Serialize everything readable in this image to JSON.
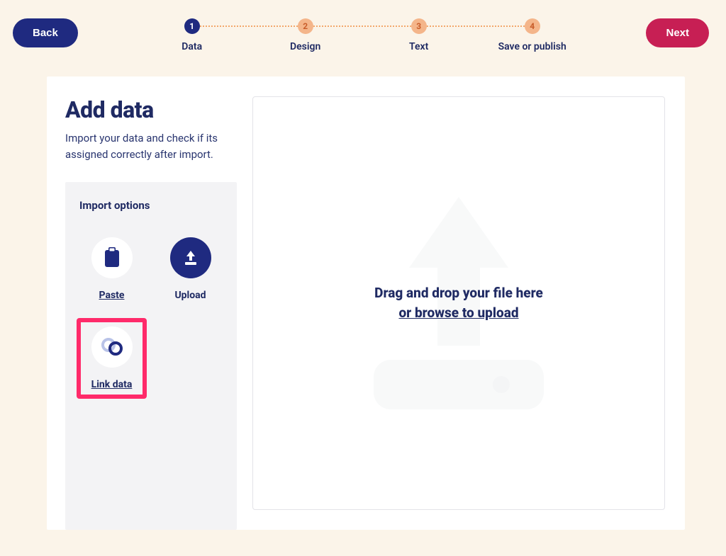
{
  "nav": {
    "back": "Back",
    "next": "Next"
  },
  "steps": [
    {
      "num": "1",
      "label": "Data",
      "state": "active"
    },
    {
      "num": "2",
      "label": "Design",
      "state": "inactive"
    },
    {
      "num": "3",
      "label": "Text",
      "state": "inactive"
    },
    {
      "num": "4",
      "label": "Save or publish",
      "state": "inactive"
    }
  ],
  "heading": {
    "title": "Add data",
    "subtitle": "Import your data and check if its assigned correctly after import."
  },
  "options": {
    "title": "Import options",
    "items": {
      "paste": "Paste",
      "upload": "Upload",
      "link": "Link data"
    }
  },
  "dropzone": {
    "line1": "Drag and drop your file here",
    "line2": "or browse to upload"
  },
  "highlight": "link"
}
